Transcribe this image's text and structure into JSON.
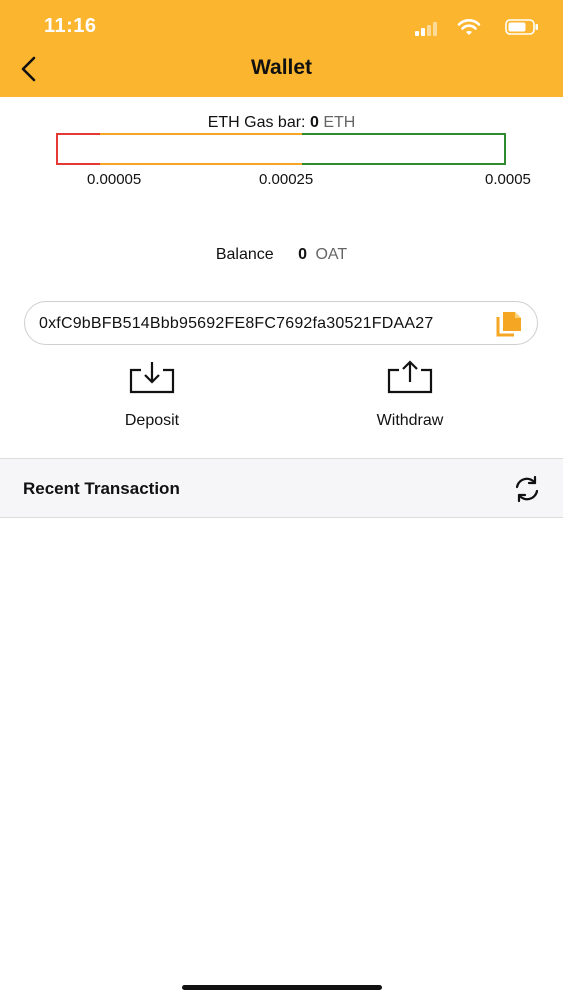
{
  "status_bar": {
    "time": "11:16"
  },
  "header": {
    "title": "Wallet"
  },
  "gas": {
    "label": "ETH Gas bar:",
    "value": "0",
    "unit": "ETH",
    "ticks": [
      "0.00005",
      "0.00025",
      "0.0005"
    ],
    "colors": {
      "low": "#E53935",
      "mid": "#F5A623",
      "high": "#2E8B2E"
    }
  },
  "balance": {
    "label": "Balance",
    "value": "0",
    "unit": "OAT"
  },
  "address": {
    "value": "0xfC9bBFB514Bbb95692FE8FC7692fa30521FDAA27"
  },
  "actions": {
    "deposit": "Deposit",
    "withdraw": "Withdraw"
  },
  "recent": {
    "title": "Recent Transaction"
  },
  "colors": {
    "accent": "#FBB52E"
  }
}
